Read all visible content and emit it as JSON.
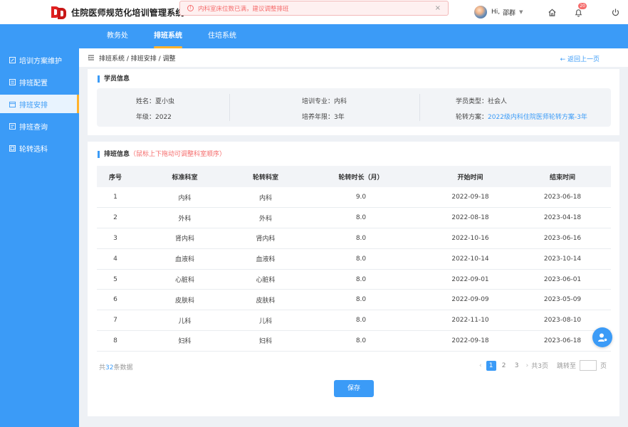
{
  "app": {
    "title": "住院医师规范化培训管理系统"
  },
  "alert": {
    "message": "内科室床位数已满，建议调整排班",
    "close": "×"
  },
  "user": {
    "greeting": "Hi,",
    "name": "邵群"
  },
  "notifications": {
    "badge": "20"
  },
  "nav": {
    "tabs": [
      "教务处",
      "排班系统",
      "住培系统"
    ],
    "active": "排班系统"
  },
  "sidebar": {
    "items": [
      {
        "label": "培训方案维护",
        "icon": "edit-icon"
      },
      {
        "label": "排班配置",
        "icon": "config-icon"
      },
      {
        "label": "排班安排",
        "icon": "schedule-icon"
      },
      {
        "label": "排班查询",
        "icon": "query-icon"
      },
      {
        "label": "轮转选科",
        "icon": "select-icon"
      }
    ],
    "active": "排班安排"
  },
  "breadcrumb": {
    "text": "排班系统 / 排班安排 / 调整",
    "back": "← 返回上一页"
  },
  "student": {
    "section_title": "学员信息",
    "name": "姓名：夏小虫",
    "major": "培训专业：内科",
    "type": "学员类型：社会人",
    "grade": "年级：2022",
    "years": "培养年限：3年",
    "plan_label": "轮转方案：",
    "plan_value": "2022级内科住院医师轮转方案-3年"
  },
  "schedule": {
    "section_title": "排班信息",
    "note": "（鼠标上下拖动可调整科室顺序）",
    "columns": [
      "序号",
      "标准科室",
      "轮转科室",
      "轮转时长（月）",
      "开始时间",
      "结束时间"
    ],
    "rows": [
      [
        "1",
        "内科",
        "内科",
        "9.0",
        "2022-09-18",
        "2023-06-18"
      ],
      [
        "2",
        "外科",
        "外科",
        "8.0",
        "2022-08-18",
        "2023-04-18"
      ],
      [
        "3",
        "肾内科",
        "肾内科",
        "8.0",
        "2022-10-16",
        "2023-06-16"
      ],
      [
        "4",
        "血液科",
        "血液科",
        "8.0",
        "2022-10-14",
        "2023-10-14"
      ],
      [
        "5",
        "心脏科",
        "心脏科",
        "8.0",
        "2022-09-01",
        "2023-06-01"
      ],
      [
        "6",
        "皮肤科",
        "皮肤科",
        "8.0",
        "2022-09-09",
        "2023-05-09"
      ],
      [
        "7",
        "儿科",
        "儿科",
        "8.0",
        "2022-11-10",
        "2023-08-10"
      ],
      [
        "8",
        "妇科",
        "妇科",
        "8.0",
        "2022-09-18",
        "2023-06-18"
      ]
    ]
  },
  "pagination": {
    "total_prefix": "共",
    "total_count": "32",
    "total_suffix": "条数据",
    "pages": [
      "1",
      "2",
      "3"
    ],
    "current": "1",
    "prev": "‹",
    "next": "›",
    "total_pages": "共3页",
    "jump_label": "跳转至",
    "jump_suffix": "页"
  },
  "actions": {
    "save": "保存"
  },
  "colors": {
    "primary": "#3b9bf7",
    "accent": "#ffb22c",
    "danger": "#f56c6c"
  }
}
